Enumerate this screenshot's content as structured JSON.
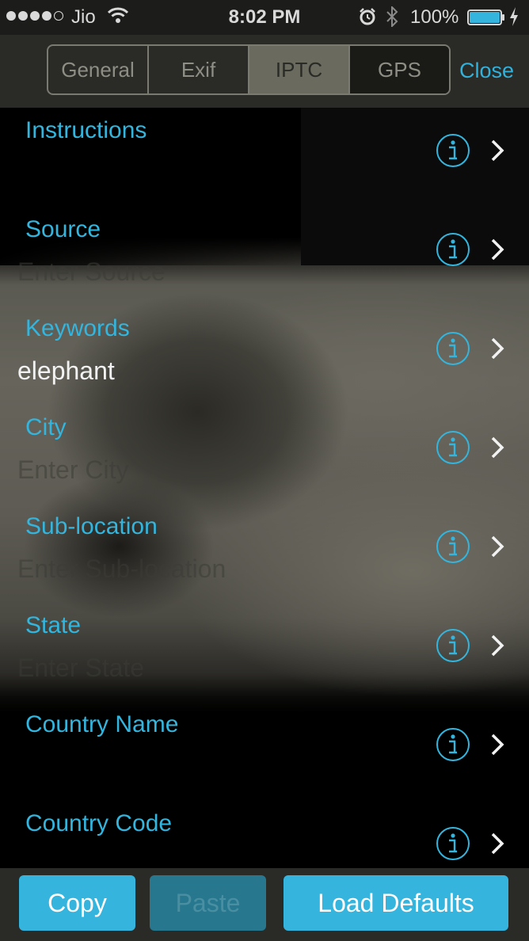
{
  "status_bar": {
    "carrier": "Jio",
    "time": "8:02 PM",
    "battery_percent": "100%",
    "icons": [
      "signal-dots",
      "wifi-icon",
      "alarm-icon",
      "bluetooth-icon",
      "battery-icon",
      "charging-icon"
    ]
  },
  "nav": {
    "tabs": [
      {
        "label": "General"
      },
      {
        "label": "Exif"
      },
      {
        "label": "IPTC"
      },
      {
        "label": "GPS"
      }
    ],
    "active_tab": "IPTC",
    "close_label": "Close"
  },
  "fields": [
    {
      "label": "Instructions",
      "value": "",
      "placeholder": ""
    },
    {
      "label": "Source",
      "value": "",
      "placeholder": "Enter Source"
    },
    {
      "label": "Keywords",
      "value": "elephant",
      "placeholder": ""
    },
    {
      "label": "City",
      "value": "",
      "placeholder": "Enter City"
    },
    {
      "label": "Sub-location",
      "value": "",
      "placeholder": "Enter Sub-location"
    },
    {
      "label": "State",
      "value": "",
      "placeholder": "Enter State"
    },
    {
      "label": "Country Name",
      "value": "",
      "placeholder": ""
    },
    {
      "label": "Country Code",
      "value": "",
      "placeholder": ""
    }
  ],
  "row_icons": [
    "info-icon",
    "chevron-right-icon"
  ],
  "toolbar": {
    "copy_label": "Copy",
    "paste_label": "Paste",
    "load_defaults_label": "Load Defaults"
  },
  "colors": {
    "accent": "#33b5dd",
    "bar_background": "#2a2b26",
    "disabled_button": "#27788f"
  }
}
